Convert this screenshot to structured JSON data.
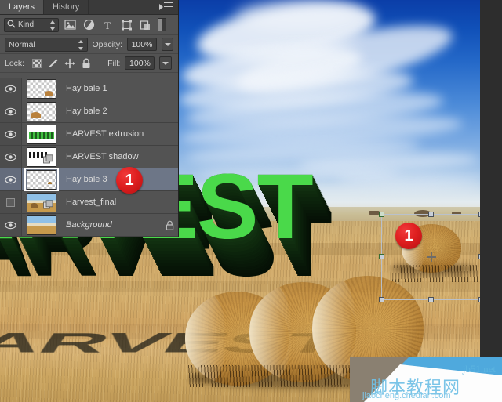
{
  "panel": {
    "tabs": [
      {
        "label": "Layers",
        "active": true
      },
      {
        "label": "History",
        "active": false
      }
    ],
    "menu_icon": "panel-menu-icon",
    "filter": {
      "search_icon": "search-icon",
      "kind_label": "Kind",
      "type_icons": [
        "pixel-layer-filter-icon",
        "adjustment-layer-filter-icon",
        "type-layer-filter-icon",
        "shape-layer-filter-icon",
        "smart-object-filter-icon"
      ],
      "toggle_icon": "filter-enable-toggle"
    },
    "blend": {
      "mode": "Normal",
      "opacity_label": "Opacity:",
      "opacity_value": "100%"
    },
    "lock": {
      "label": "Lock:",
      "icons": [
        "lock-transparent-pixels-icon",
        "lock-image-pixels-icon",
        "lock-position-icon",
        "lock-all-icon"
      ],
      "fill_label": "Fill:",
      "fill_value": "100%"
    },
    "layers": [
      {
        "name": "Hay bale 1",
        "visible": true,
        "selected": false,
        "locked": false,
        "italic": false,
        "thumb": "transparent-haybale-small"
      },
      {
        "name": "Hay bale 2",
        "visible": true,
        "selected": false,
        "locked": false,
        "italic": false,
        "thumb": "transparent-haybale-small"
      },
      {
        "name": "HARVEST extrusion",
        "visible": true,
        "selected": false,
        "locked": false,
        "italic": false,
        "thumb": "green-text-extrusion"
      },
      {
        "name": "HARVEST shadow",
        "visible": true,
        "selected": false,
        "locked": false,
        "italic": false,
        "thumb": "dark-text-shadow",
        "badge": "3d-object-icon"
      },
      {
        "name": "Hay bale 3",
        "visible": true,
        "selected": true,
        "locked": false,
        "italic": false,
        "thumb": "empty-transparent"
      },
      {
        "name": "Harvest_final",
        "visible": false,
        "selected": false,
        "locked": false,
        "italic": false,
        "thumb": "composite-photo",
        "badge": "smart-object-icon"
      },
      {
        "name": "Background",
        "visible": true,
        "selected": false,
        "locked": true,
        "italic": true,
        "thumb": "field-photo"
      }
    ]
  },
  "canvas": {
    "artwork_text": "HARVEST",
    "selection": {
      "name": "free-transform-bounding-box",
      "handles": [
        "top-left",
        "top-center",
        "top-right",
        "middle-left",
        "middle-right",
        "bottom-left",
        "bottom-center",
        "bottom-right"
      ],
      "reference_point": "center"
    }
  },
  "annotations": {
    "badge_layer": "1",
    "badge_canvas": "1"
  },
  "watermark": {
    "site": "jb51.net",
    "chinese": "脚本教程网",
    "url": "jiaocheng.chedian.com"
  },
  "colors": {
    "panel_bg": "#535353",
    "panel_tabbar": "#3a3a3a",
    "selected_row": "#6d7687",
    "badge_red": "#df1f20",
    "type_green": "#4ad94a",
    "sky_blue": "#1050b8",
    "field_tan": "#d2b071"
  }
}
